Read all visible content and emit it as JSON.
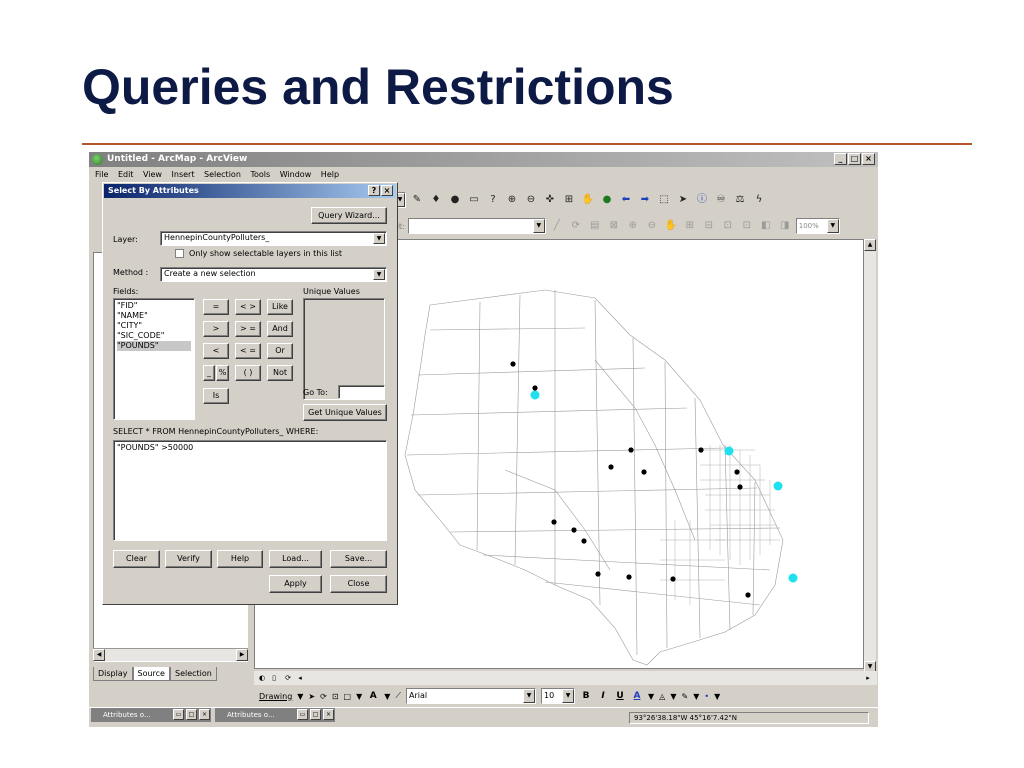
{
  "slide": {
    "title": "Queries and Restrictions"
  },
  "window": {
    "title": "Untitled - ArcMap - ArcView",
    "minimize": "_",
    "maximize": "□",
    "close": "×"
  },
  "menu": [
    "File",
    "Edit",
    "View",
    "Insert",
    "Selection",
    "Tools",
    "Window",
    "Help"
  ],
  "toolbar2": {
    "target_label": "et:",
    "zoom": "100%"
  },
  "toc": {
    "tabs": [
      "Display",
      "Source",
      "Selection"
    ],
    "active_tab": "Source"
  },
  "drawing": {
    "menu_label": "Drawing",
    "font_name": "Arial",
    "font_size": "10",
    "bold": "B",
    "italic": "I",
    "underline": "U"
  },
  "status": {
    "coordinates": "93°26'38.18\"W  45°16'7.42\"N"
  },
  "taskbar": [
    {
      "label": "Attributes o..."
    },
    {
      "label": "Attributes o..."
    }
  ],
  "dialog": {
    "title": "Select By Attributes",
    "help_btn": "?",
    "close_btn": "×",
    "query_wizard": "Query Wizard...",
    "layer_label": "Layer:",
    "layer_value": "HennepinCountyPolluters_",
    "only_selectable": "Only show selectable layers in this list",
    "method_label": "Method :",
    "method_value": "Create a new selection",
    "fields_label": "Fields:",
    "fields": [
      "\"FID\"",
      "\"NAME\"",
      "\"CITY\"",
      "\"SIC_CODE\"",
      "\"POUNDS\""
    ],
    "selected_field": "\"POUNDS\"",
    "unique_values_label": "Unique Values",
    "operators": {
      "eq": "=",
      "neq": "< >",
      "like": "Like",
      "gt": ">",
      "gte": "> =",
      "and": "And",
      "lt": "<",
      "lte": "< =",
      "or": "Or",
      "underscore": "_",
      "percent": "%",
      "parens": "( )",
      "not": "Not",
      "is": "Is"
    },
    "goto_label": "Go To:",
    "get_unique": "Get Unique Values",
    "sql_prefix": "SELECT * FROM HennepinCountyPolluters_ WHERE:",
    "expression": "\"POUNDS\" >50000",
    "buttons": {
      "clear": "Clear",
      "verify": "Verify",
      "help": "Help",
      "load": "Load...",
      "save": "Save...",
      "apply": "Apply",
      "close": "Close"
    }
  },
  "map_points": {
    "black": [
      [
        512,
        363
      ],
      [
        534,
        387
      ],
      [
        610,
        466
      ],
      [
        643,
        471
      ],
      [
        630,
        449
      ],
      [
        553,
        521
      ],
      [
        573,
        529
      ],
      [
        583,
        540
      ],
      [
        597,
        573
      ],
      [
        628,
        576
      ],
      [
        672,
        578
      ],
      [
        747,
        594
      ],
      [
        739,
        486
      ],
      [
        736,
        471
      ],
      [
        700,
        449
      ]
    ],
    "cyan": [
      [
        534,
        394
      ],
      [
        728,
        450
      ],
      [
        777,
        485
      ],
      [
        792,
        577
      ]
    ]
  }
}
